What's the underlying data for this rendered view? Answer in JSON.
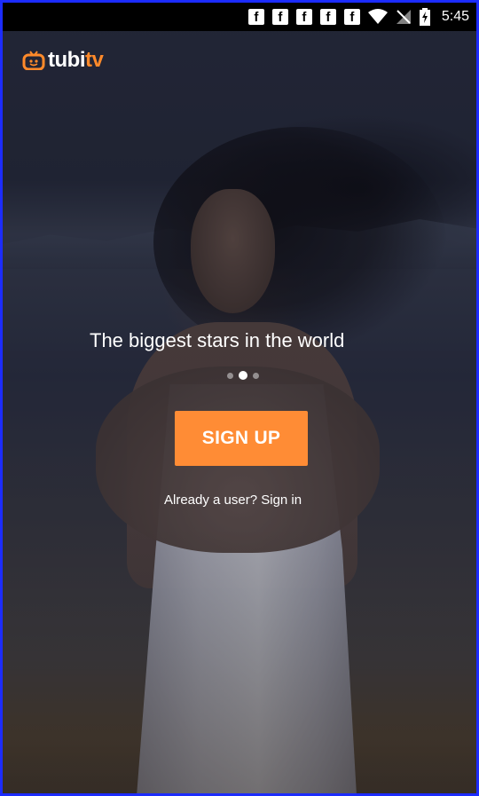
{
  "status_bar": {
    "notification_icons": [
      "f",
      "f",
      "f",
      "f",
      "f"
    ],
    "wifi_icon": "wifi-icon",
    "signal_icon": "no-signal-icon",
    "battery_icon": "battery-charging-icon",
    "time": "5:45"
  },
  "logo": {
    "icon": "tv-icon",
    "text_main": "tubi",
    "text_accent": "tv",
    "accent_color": "#ff8a2a"
  },
  "onboarding": {
    "headline": "The biggest stars in the world",
    "page_count": 3,
    "active_page": 2
  },
  "actions": {
    "signup_label": "SIGN UP",
    "signup_color": "#ff8c35",
    "signin_text": "Already a user?  Sign in"
  }
}
